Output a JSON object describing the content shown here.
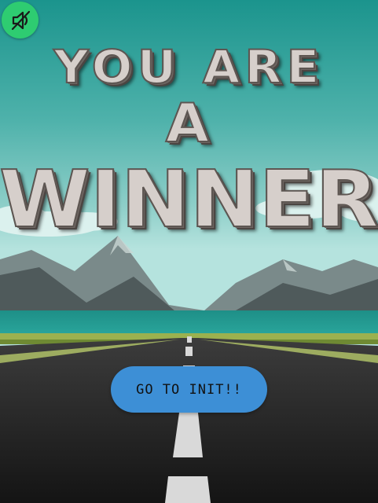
{
  "title": {
    "line1": "YOU ARE",
    "line2": "A",
    "line3": "WINNER"
  },
  "go_button": {
    "label": "GO TO INIT!!"
  },
  "mute_icon": "sound-muted-icon",
  "colors": {
    "sky_top": "#1f9a93",
    "sky_bottom": "#a8ddd7",
    "mountains": "#5f6b6c",
    "grass": "#8ea84a",
    "road": "#2a2a2a",
    "button": "#3d8fd6",
    "mute_badge": "#2ecc71",
    "title_stone": "#d6cfcb"
  }
}
